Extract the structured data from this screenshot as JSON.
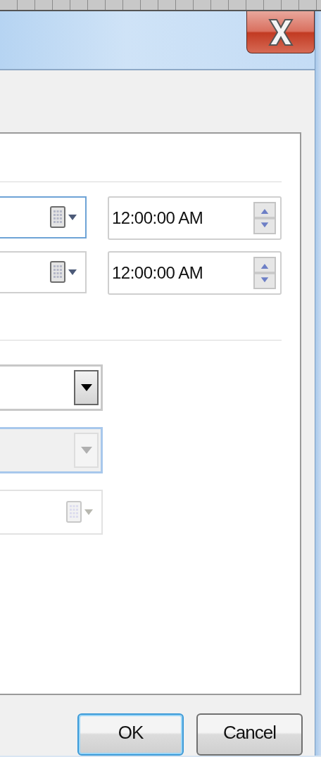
{
  "date_time_rows": [
    {
      "date_focused": true,
      "time": "12:00:00 AM"
    },
    {
      "date_focused": false,
      "time": "12:00:00 AM"
    }
  ],
  "lower_fields": [
    {
      "kind": "combo",
      "disabled": false,
      "focused": false
    },
    {
      "kind": "combo",
      "disabled": true,
      "focused": true
    },
    {
      "kind": "date",
      "disabled": true,
      "focused": false
    }
  ],
  "buttons": [
    {
      "label": "OK",
      "default": true
    },
    {
      "label": "Cancel",
      "default": false
    }
  ]
}
